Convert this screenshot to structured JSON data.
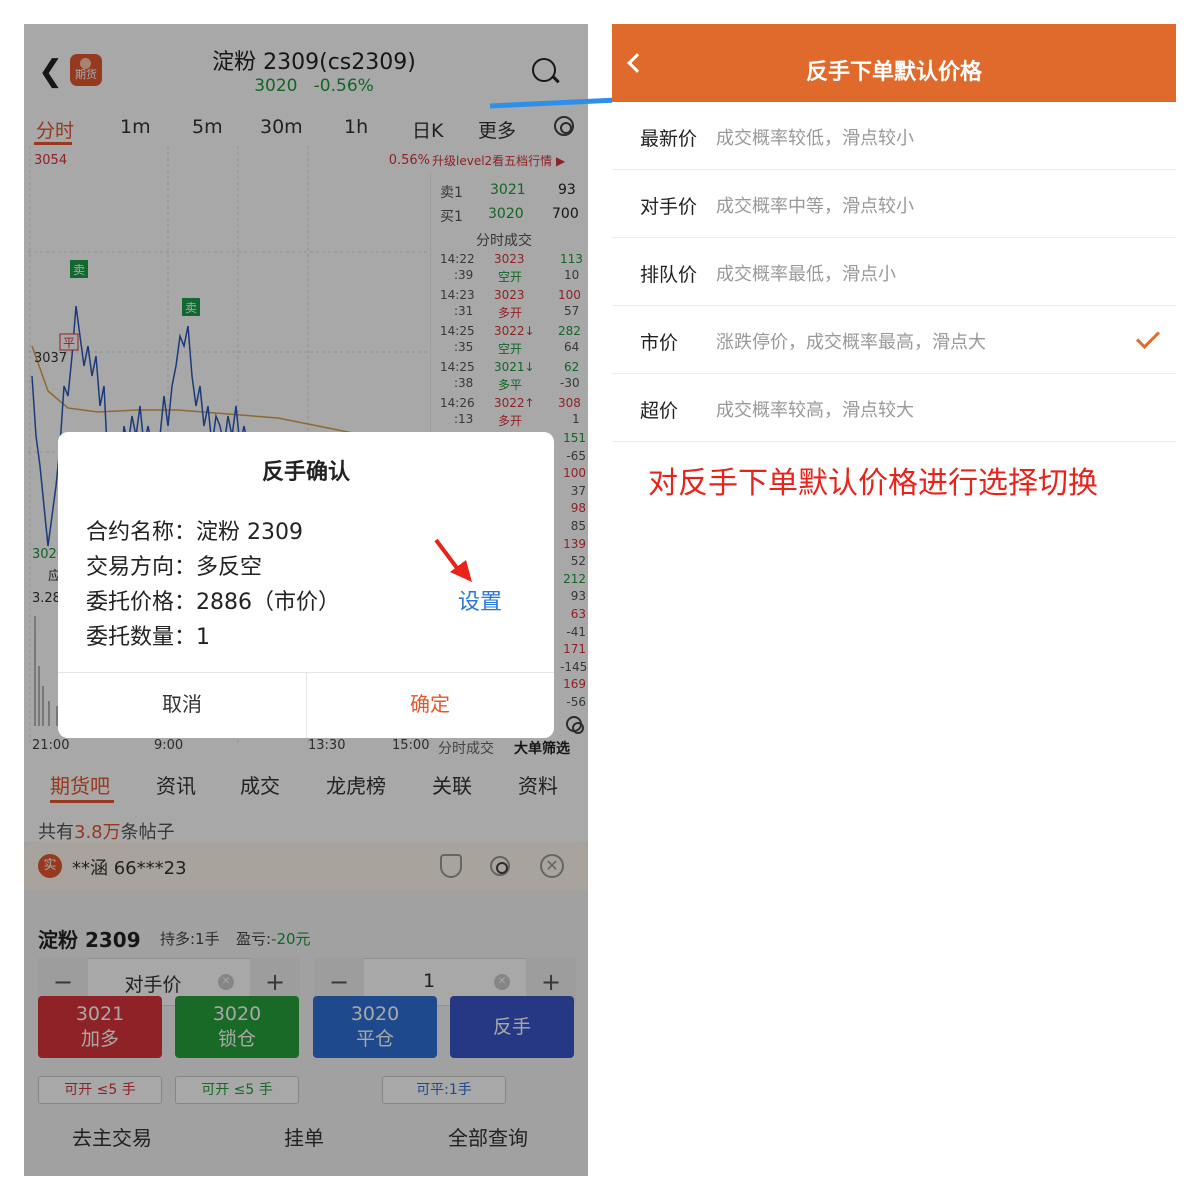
{
  "left": {
    "header": {
      "logo_text": "期货",
      "title": "淀粉 2309(cs2309)",
      "price": "3020",
      "change": "-0.56%"
    },
    "timeframes": [
      "分时",
      "1m",
      "5m",
      "30m",
      "1h",
      "日K",
      "更多"
    ],
    "chart": {
      "y_top": "3054",
      "y_mid": "3037",
      "y_low": "3020",
      "pct_top": "0.56%",
      "upgrade": "升级level2看五档行情 ▶",
      "left_label_1": "应",
      "left_label_2": "3.28",
      "x_ticks": [
        "21:00",
        "9:00",
        "13:30",
        "15:00"
      ],
      "marker_sell_1": "卖",
      "marker_sell_2": "卖",
      "marker_flat": "平"
    },
    "orderbook": {
      "sell1_label": "卖1",
      "sell1_price": "3021",
      "sell1_qty": "93",
      "buy1_label": "买1",
      "buy1_price": "3020",
      "buy1_qty": "700",
      "trades_title": "分时成交",
      "trades": [
        {
          "time": "14:22",
          "price": "3023",
          "qty": "113",
          "sub": ":39",
          "kind": "空开",
          "delta": "10"
        },
        {
          "time": "14:23",
          "price": "3023",
          "qty": "100",
          "sub": ":31",
          "kind": "多开",
          "delta": "57"
        },
        {
          "time": "14:25",
          "price": "3022↓",
          "qty": "282",
          "sub": ":35",
          "kind": "空开",
          "delta": "64"
        },
        {
          "time": "14:25",
          "price": "3021↓",
          "qty": "62",
          "sub": ":38",
          "kind": "多平",
          "delta": "-30"
        },
        {
          "time": "14:26",
          "price": "3022↑",
          "qty": "308",
          "sub": ":13",
          "kind": "多开",
          "delta": "1"
        }
      ],
      "extra_vals": [
        "151",
        "-65",
        "100",
        "37",
        "98",
        "85",
        "139",
        "52",
        "212",
        "93",
        "63",
        "-41",
        "171",
        "-145",
        "169",
        "-56"
      ],
      "tab_1": "分时成交",
      "tab_2": "大单筛选"
    },
    "dialog": {
      "title": "反手确认",
      "contract_label": "合约名称：",
      "contract_value": "淀粉 2309",
      "direction_label": "交易方向：",
      "direction_value": "多反空",
      "price_label": "委托价格：",
      "price_value": "2886（市价）",
      "qty_label": "委托数量：",
      "qty_value": "1",
      "settings_link": "设置",
      "cancel": "取消",
      "confirm": "确定"
    },
    "nav_tabs": [
      "期货吧",
      "资讯",
      "成交",
      "龙虎榜",
      "关联",
      "资料"
    ],
    "posts": {
      "prefix": "共有",
      "count": "3.8万",
      "suffix": "条帖子"
    },
    "account": {
      "badge": "实",
      "name": "**涵  66***23"
    },
    "position": {
      "contract": "淀粉 2309",
      "holding": "持多:1手",
      "pnl_label": "盈亏:",
      "pnl_value": "-20元"
    },
    "price_input": {
      "minus": "−",
      "value": "对手价",
      "plus": "+"
    },
    "qty_input": {
      "minus": "−",
      "value": "1",
      "plus": "+"
    },
    "actions": [
      {
        "price": "3021",
        "label": "加多",
        "color": "#d8343a"
      },
      {
        "price": "3020",
        "label": "锁仓",
        "color": "#27a13a"
      },
      {
        "price": "3020",
        "label": "平仓",
        "color": "#2f6fd6"
      },
      {
        "price": "",
        "label": "反手",
        "color": "#3a56c9"
      }
    ],
    "capacity": [
      "可开 ≤5 手",
      "可开 ≤5 手",
      "可平:1手"
    ],
    "bottom_links": [
      "去主交易",
      "挂单",
      "全部查询"
    ]
  },
  "right": {
    "title": "反手下单默认价格",
    "options": [
      {
        "name": "最新价",
        "desc": "成交概率较低，滑点较小",
        "selected": false
      },
      {
        "name": "对手价",
        "desc": "成交概率中等，滑点较小",
        "selected": false
      },
      {
        "name": "排队价",
        "desc": "成交概率最低，滑点小",
        "selected": false
      },
      {
        "name": "市价",
        "desc": "涨跌停价，成交概率最高，滑点大",
        "selected": true
      },
      {
        "name": "超价",
        "desc": "成交概率较高，滑点较大",
        "selected": false
      }
    ],
    "annotation": "对反手下单默认价格进行选择切换"
  },
  "colors": {
    "accent": "#e06a2c",
    "up": "#d8343a",
    "down": "#27a13a",
    "link": "#2a78d6",
    "annotation": "#e8231a"
  }
}
